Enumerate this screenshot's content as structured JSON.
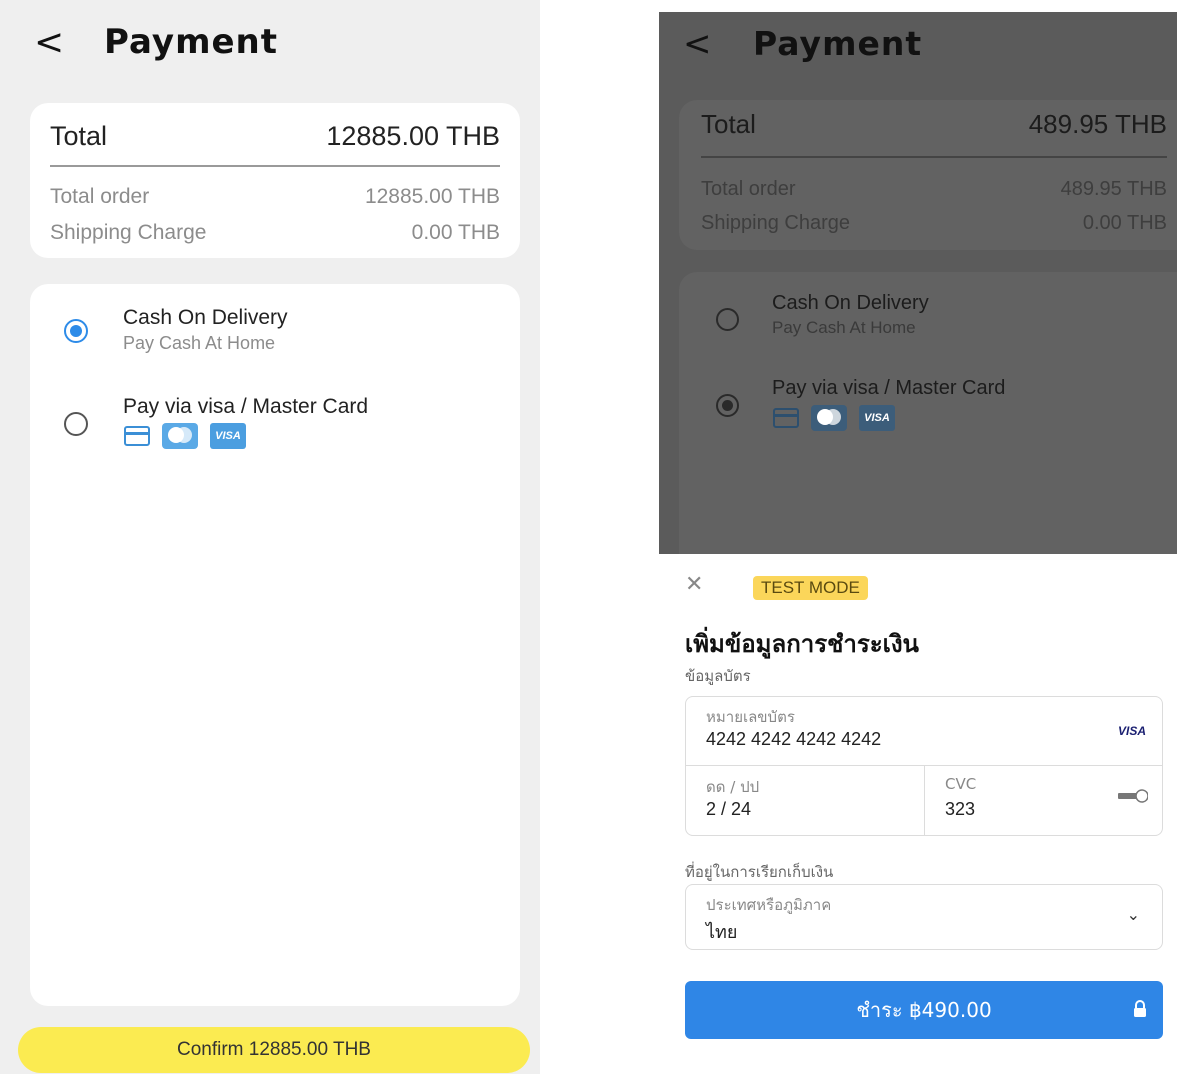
{
  "left": {
    "title": "Payment",
    "summary": {
      "total_label": "Total",
      "total_value": "12885.00 THB",
      "order_label": "Total order",
      "order_value": "12885.00 THB",
      "shipping_label": "Shipping Charge",
      "shipping_value": "0.00 THB"
    },
    "methods": [
      {
        "title": "Cash On Delivery",
        "subtitle": "Pay Cash At Home",
        "selected": true
      },
      {
        "title": "Pay via visa / Master Card",
        "selected": false
      }
    ],
    "card_icons": [
      "credit-card-icon",
      "mastercard-icon",
      "visa-icon"
    ],
    "visa_label": "VISA",
    "confirm_label": "Confirm 12885.00 THB"
  },
  "right": {
    "title": "Payment",
    "summary": {
      "total_label": "Total",
      "total_value": "489.95 THB",
      "order_label": "Total order",
      "order_value": "489.95 THB",
      "shipping_label": "Shipping Charge",
      "shipping_value": "0.00 THB"
    },
    "methods": [
      {
        "title": "Cash On Delivery",
        "subtitle": "Pay Cash At Home",
        "selected": false
      },
      {
        "title": "Pay via visa / Master Card",
        "selected": true
      }
    ],
    "visa_label": "VISA",
    "sheet": {
      "test_mode": "TEST MODE",
      "title": "เพิ่มข้อมูลการชำระเงิน",
      "card_section": "ข้อมูลบัตร",
      "card_number_label": "หมายเลขบัตร",
      "card_number": "4242 4242 4242 4242",
      "card_brand": "VISA",
      "expiry_label": "ดด / ปป",
      "expiry": "2 / 24",
      "cvc_label": "CVC",
      "cvc": "323",
      "billing_section": "ที่อยู่ในการเรียกเก็บเงิน",
      "country_label": "ประเทศหรือภูมิภาค",
      "country": "ไทย",
      "pay_label": "ชำระ ฿490.00"
    }
  },
  "colors": {
    "accent_blue": "#2f86e6",
    "confirm_yellow": "#fbeb51",
    "test_badge": "#fbd65a"
  }
}
